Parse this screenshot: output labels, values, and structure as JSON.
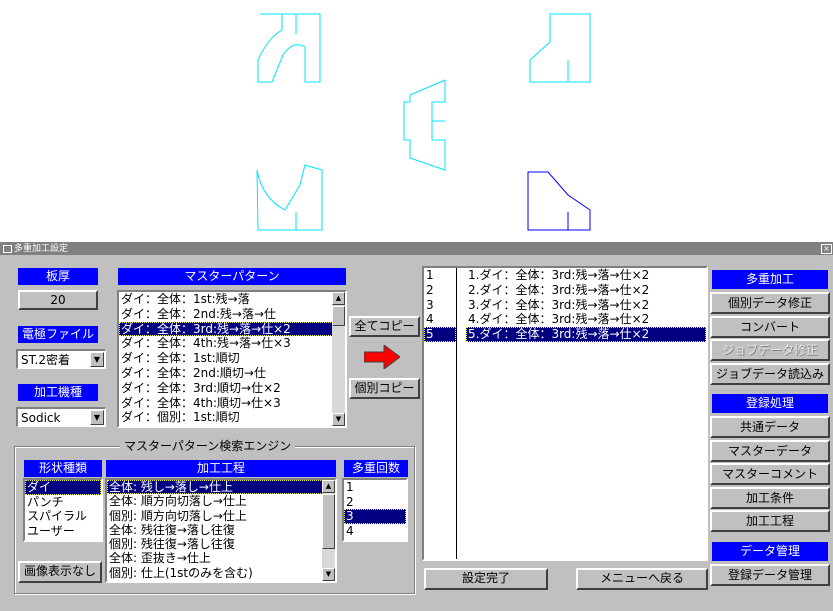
{
  "window": {
    "title": "多重加工設定",
    "close": "×"
  },
  "left": {
    "thickness": {
      "header": "板厚",
      "value": "20"
    },
    "electrode": {
      "header": "電極ファイル",
      "value": "ST.2密着"
    },
    "machine": {
      "header": "加工機種",
      "value": "Sodick"
    }
  },
  "master_pattern": {
    "header": "マスターパターン",
    "items": [
      "ダイ：全体：1st:残→落",
      "ダイ：全体：2nd:残→落→仕",
      "ダイ：全体：3rd:残→落→仕×2",
      "ダイ：全体：4th:残→落→仕×3",
      "ダイ：全体：1st:順切",
      "ダイ：全体：2nd:順切→仕",
      "ダイ：全体：3rd:順切→仕×2",
      "ダイ：全体：4th:順切→仕×3",
      "ダイ：個別：1st:順切"
    ],
    "selected": 2
  },
  "copy_all_label": "全てコピー",
  "copy_one_label": "個別コピー",
  "search": {
    "title": "マスターパターン検索エンジン",
    "shape": {
      "header": "形状種類",
      "items": [
        "ダイ",
        "パンチ",
        "スパイラル",
        "ユーザー"
      ],
      "selected": 0
    },
    "process": {
      "header": "加工工程",
      "items": [
        "全体:  残し→落し→仕上",
        "全体:  順方向切落し→仕上",
        "個別:  順方向切落し→仕上",
        "全体:  残往復→落し往復",
        "個別:  残往復→落し往復",
        "全体:  歪抜き→仕上",
        "個別:  仕上(1stのみを含む)"
      ],
      "selected": 0
    },
    "count": {
      "header": "多重回数",
      "items": [
        "1",
        "2",
        "3",
        "4"
      ],
      "selected": 2
    },
    "image_toggle": "画像表示なし"
  },
  "assigned": {
    "numbers": [
      "1",
      "2",
      "3",
      "4",
      "5"
    ],
    "items": [
      "1.ダイ：全体：3rd:残→落→仕×2",
      "2.ダイ：全体：3rd:残→落→仕×2",
      "3.ダイ：全体：3rd:残→落→仕×2",
      "4.ダイ：全体：3rd:残→落→仕×2",
      "5.ダイ：全体：3rd:残→落→仕×2"
    ],
    "selected": 4
  },
  "bottom_buttons": {
    "done": "設定完了",
    "menu": "メニューへ戻る"
  },
  "right_panel": {
    "sections": [
      {
        "header": "多重加工",
        "buttons": [
          {
            "label": "個別データ修正",
            "disabled": false
          },
          {
            "label": "コンバート",
            "disabled": false
          },
          {
            "label": "ジョブデータ修正",
            "disabled": true
          },
          {
            "label": "ジョブデータ読込み",
            "disabled": false
          }
        ]
      },
      {
        "header": "登録処理",
        "buttons": [
          {
            "label": "共通データ",
            "disabled": false
          },
          {
            "label": "マスターデータ",
            "disabled": false
          },
          {
            "label": "マスターコメント",
            "disabled": false
          },
          {
            "label": "加工条件",
            "disabled": false
          },
          {
            "label": "加工工程",
            "disabled": false
          }
        ]
      },
      {
        "header": "データ管理",
        "buttons": [
          {
            "label": "登録データ管理",
            "disabled": false
          }
        ]
      }
    ]
  },
  "colors": {
    "accent": "#0000ff",
    "selection": "#000080",
    "shape_cyan": "#00e5ff",
    "shape_blue": "#0000ff",
    "arrow_red": "#ff0000"
  }
}
